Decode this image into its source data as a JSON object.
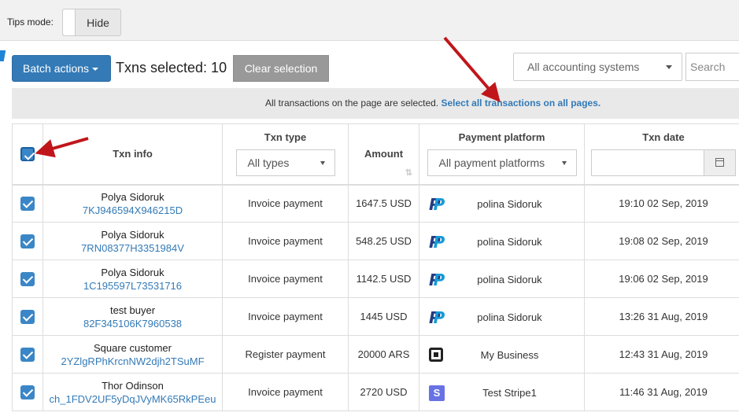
{
  "tips": {
    "label": "Tips mode:",
    "toggle_text": "Hide"
  },
  "actions": {
    "batch_label": "Batch actions",
    "txns_selected": "Txns selected: 10",
    "clear_label": "Clear selection",
    "accounting_select": "All accounting systems",
    "search_placeholder": "Search"
  },
  "notice": {
    "text": "All transactions on the page are selected.",
    "select_all_link": "Select all transactions on all pages."
  },
  "table": {
    "headers": {
      "txn_info": "Txn info",
      "txn_type": "Txn type",
      "txn_type_filter": "All types",
      "amount": "Amount",
      "platform": "Payment platform",
      "platform_filter": "All payment platforms",
      "date": "Txn date"
    },
    "rows": [
      {
        "buyer": "Polya Sidoruk",
        "txn_id": "7KJ946594X946215D",
        "type": "Invoice payment",
        "amount": "1647.5 USD",
        "platform_icon": "paypal-icon",
        "platform_name": "polina Sidoruk",
        "date": "19:10 02 Sep, 2019"
      },
      {
        "buyer": "Polya Sidoruk",
        "txn_id": "7RN08377H3351984V",
        "type": "Invoice payment",
        "amount": "548.25 USD",
        "platform_icon": "paypal-icon",
        "platform_name": "polina Sidoruk",
        "date": "19:08 02 Sep, 2019"
      },
      {
        "buyer": "Polya Sidoruk",
        "txn_id": "1C195597L73531716",
        "type": "Invoice payment",
        "amount": "1142.5 USD",
        "platform_icon": "paypal-icon",
        "platform_name": "polina Sidoruk",
        "date": "19:06 02 Sep, 2019"
      },
      {
        "buyer": "test buyer",
        "txn_id": "82F345106K7960538",
        "type": "Invoice payment",
        "amount": "1445 USD",
        "platform_icon": "paypal-icon",
        "platform_name": "polina Sidoruk",
        "date": "13:26 31 Aug, 2019"
      },
      {
        "buyer": "Square customer",
        "txn_id": "2YZlgRPhKrcnNW2djh2TSuMF",
        "type": "Register payment",
        "amount": "20000 ARS",
        "platform_icon": "square-icon",
        "platform_name": "My Business",
        "date": "12:43 31 Aug, 2019"
      },
      {
        "buyer": "Thor Odinson",
        "txn_id": "ch_1FDV2UF5yDqJVyMK65RkPEeu",
        "type": "Invoice payment",
        "amount": "2720 USD",
        "platform_icon": "stripe-icon",
        "platform_name": "Test Stripe1",
        "date": "11:46 31 Aug, 2019"
      }
    ]
  },
  "colors": {
    "primary": "#337ab7",
    "checkbox": "#3b86c6",
    "annotation": "#c0161b",
    "paypal_dark": "#253b80",
    "paypal_light": "#179bd7",
    "stripe": "#6772e5"
  }
}
